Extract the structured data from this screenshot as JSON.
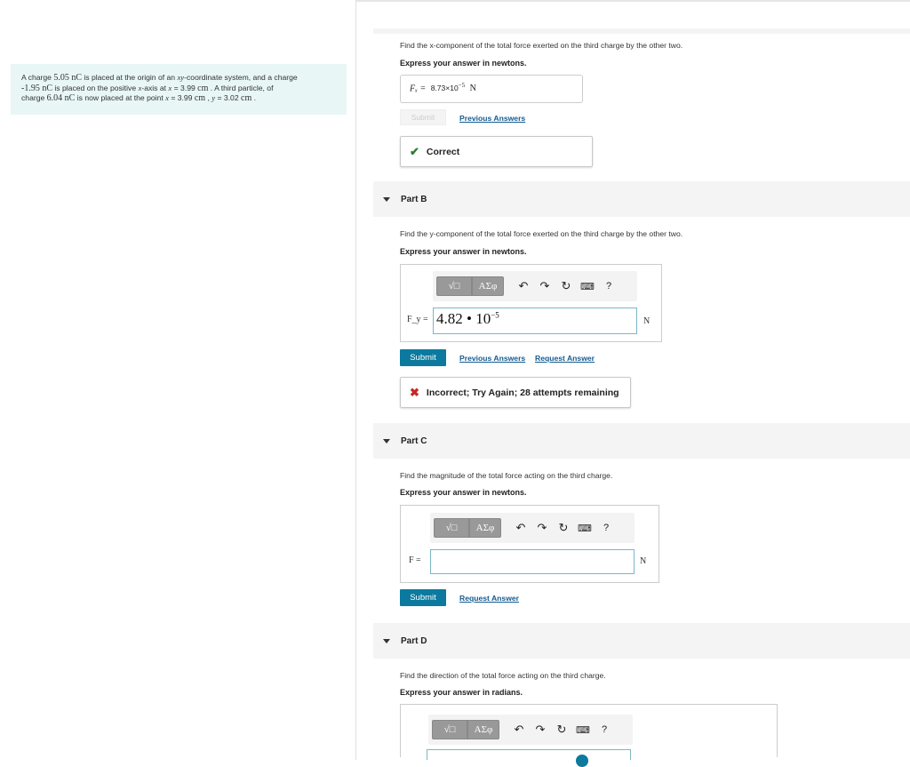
{
  "problem": {
    "t1": "A charge ",
    "q1": "5.05 nC",
    "t2": " is placed at the origin of an ",
    "xy": "xy",
    "t3": "-coordinate system, and a charge",
    "q2": "-1.95 nC",
    "t4": " is placed on the positive ",
    "xaxis": "x",
    "t5": "-axis at ",
    "xeq": "x",
    "t6": " = 3.99 ",
    "cm1": "cm",
    "t7": " . A third particle, of",
    "t8": "charge ",
    "q3": "6.04 nC",
    "t9": " is now placed at the point ",
    "px": "x",
    "t10": " = 3.99 ",
    "cm2": "cm",
    "t11": " , ",
    "py": "y",
    "t12": " = 3.02 ",
    "cm3": "cm",
    "t13": " ."
  },
  "part_a": {
    "question": "Find the x-component of the total force exerted on the third charge by the other two.",
    "instruction": "Express your answer in newtons.",
    "answer_label": "Fₓ =",
    "answer_mantissa": "8.73×10",
    "answer_exp": "−5",
    "answer_unit": "N",
    "submit_label": "Submit",
    "previous_answers": "Previous Answers",
    "feedback": "Correct"
  },
  "part_b": {
    "title": "Part B",
    "question": "Find the y-component of the total force exerted on the third charge by the other two.",
    "instruction": "Express your answer in newtons.",
    "label": "F_y =",
    "value_mantissa": "4.82 • 10",
    "value_exp": "−5",
    "unit": "N",
    "submit_label": "Submit",
    "previous_answers": "Previous Answers",
    "request_answer": "Request Answer",
    "feedback": "Incorrect; Try Again; 28 attempts remaining"
  },
  "part_c": {
    "title": "Part C",
    "question": "Find the magnitude of the total force acting on the third charge.",
    "instruction": "Express your answer in newtons.",
    "label": "F =",
    "value": "",
    "unit": "N",
    "submit_label": "Submit",
    "request_answer": "Request Answer"
  },
  "part_d": {
    "title": "Part D",
    "question": "Find the direction of the total force acting on the third charge.",
    "instruction": "Express your answer in radians."
  },
  "toolbar": {
    "templates_label": "√□",
    "greek_label": "ΑΣφ",
    "undo_icon": "↶",
    "redo_icon": "↷",
    "reset_icon": "↻",
    "keyboard_icon": "⌨",
    "help_icon": "?"
  },
  "colors": {
    "accent": "#0b7a9e",
    "correct": "#2e7d32",
    "incorrect": "#c62828",
    "problem_bg": "#e8f6f6"
  }
}
